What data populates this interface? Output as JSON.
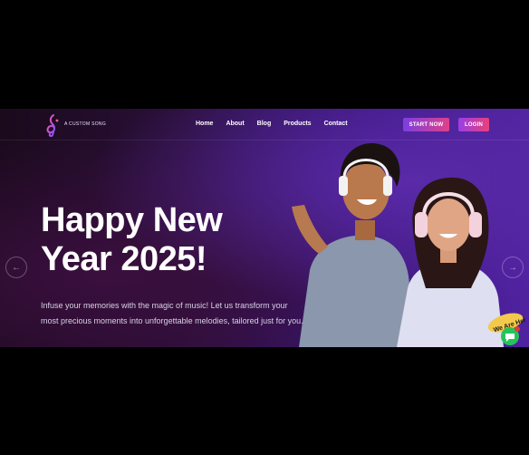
{
  "brand": {
    "logo_text": "A CUSTOM SONG"
  },
  "nav": {
    "items": [
      {
        "label": "Home"
      },
      {
        "label": "About"
      },
      {
        "label": "Blog"
      },
      {
        "label": "Products"
      },
      {
        "label": "Contact"
      }
    ]
  },
  "actions": {
    "start_label": "START NOW",
    "login_label": "LOGIN"
  },
  "hero": {
    "headline_line1": "Happy New",
    "headline_line2": "Year 2025!",
    "subtext": "Infuse your memories with the magic of music! Let us transform your most precious moments into unforgettable melodies, tailored just for you."
  },
  "carousel": {
    "prev_icon": "chevron-left-icon",
    "next_icon": "chevron-right-icon"
  },
  "chat_badge": {
    "text": "We Are Here!",
    "icon": "chat-icon"
  },
  "colors": {
    "accent_start": "#7b3fe0",
    "accent_end": "#e0408a",
    "chat_green": "#25c45a"
  }
}
